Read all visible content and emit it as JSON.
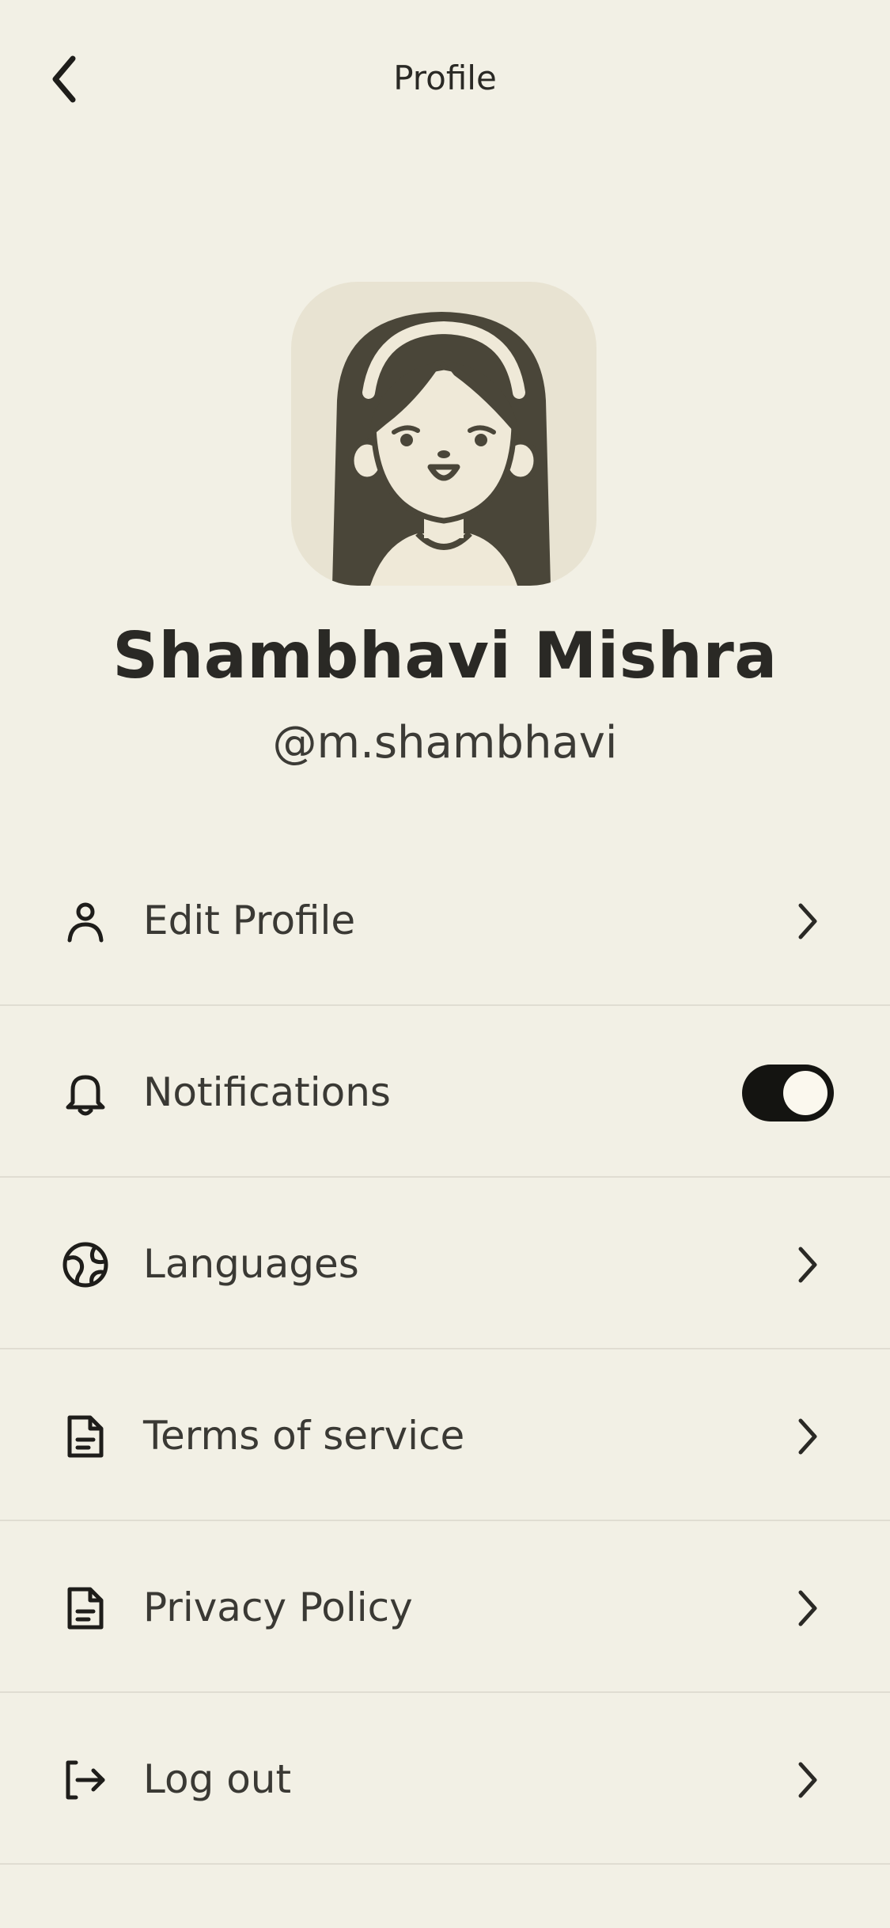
{
  "header": {
    "title": "Profile",
    "back_icon": "chevron-left-icon"
  },
  "profile": {
    "name": "Shambhavi Mishra",
    "handle": "@m.shambhavi",
    "avatar": "girl-avatar-illustration"
  },
  "menu": {
    "items": [
      {
        "label": "Edit Profile",
        "icon": "person-icon",
        "trailing": "chevron-right-icon"
      },
      {
        "label": "Notifications",
        "icon": "bell-icon",
        "trailing": "toggle",
        "toggle_on": true
      },
      {
        "label": "Languages",
        "icon": "globe-icon",
        "trailing": "chevron-right-icon"
      },
      {
        "label": "Terms of service",
        "icon": "document-icon",
        "trailing": "chevron-right-icon"
      },
      {
        "label": "Privacy Policy",
        "icon": "document-icon",
        "trailing": "chevron-right-icon"
      },
      {
        "label": "Log out",
        "icon": "logout-icon",
        "trailing": "chevron-right-icon"
      }
    ]
  },
  "colors": {
    "background": "#f2f0e5",
    "text": "#2a2925",
    "toggle_on": "#141411",
    "avatar_bg": "#e8e3d2",
    "hair": "#4a4639"
  }
}
